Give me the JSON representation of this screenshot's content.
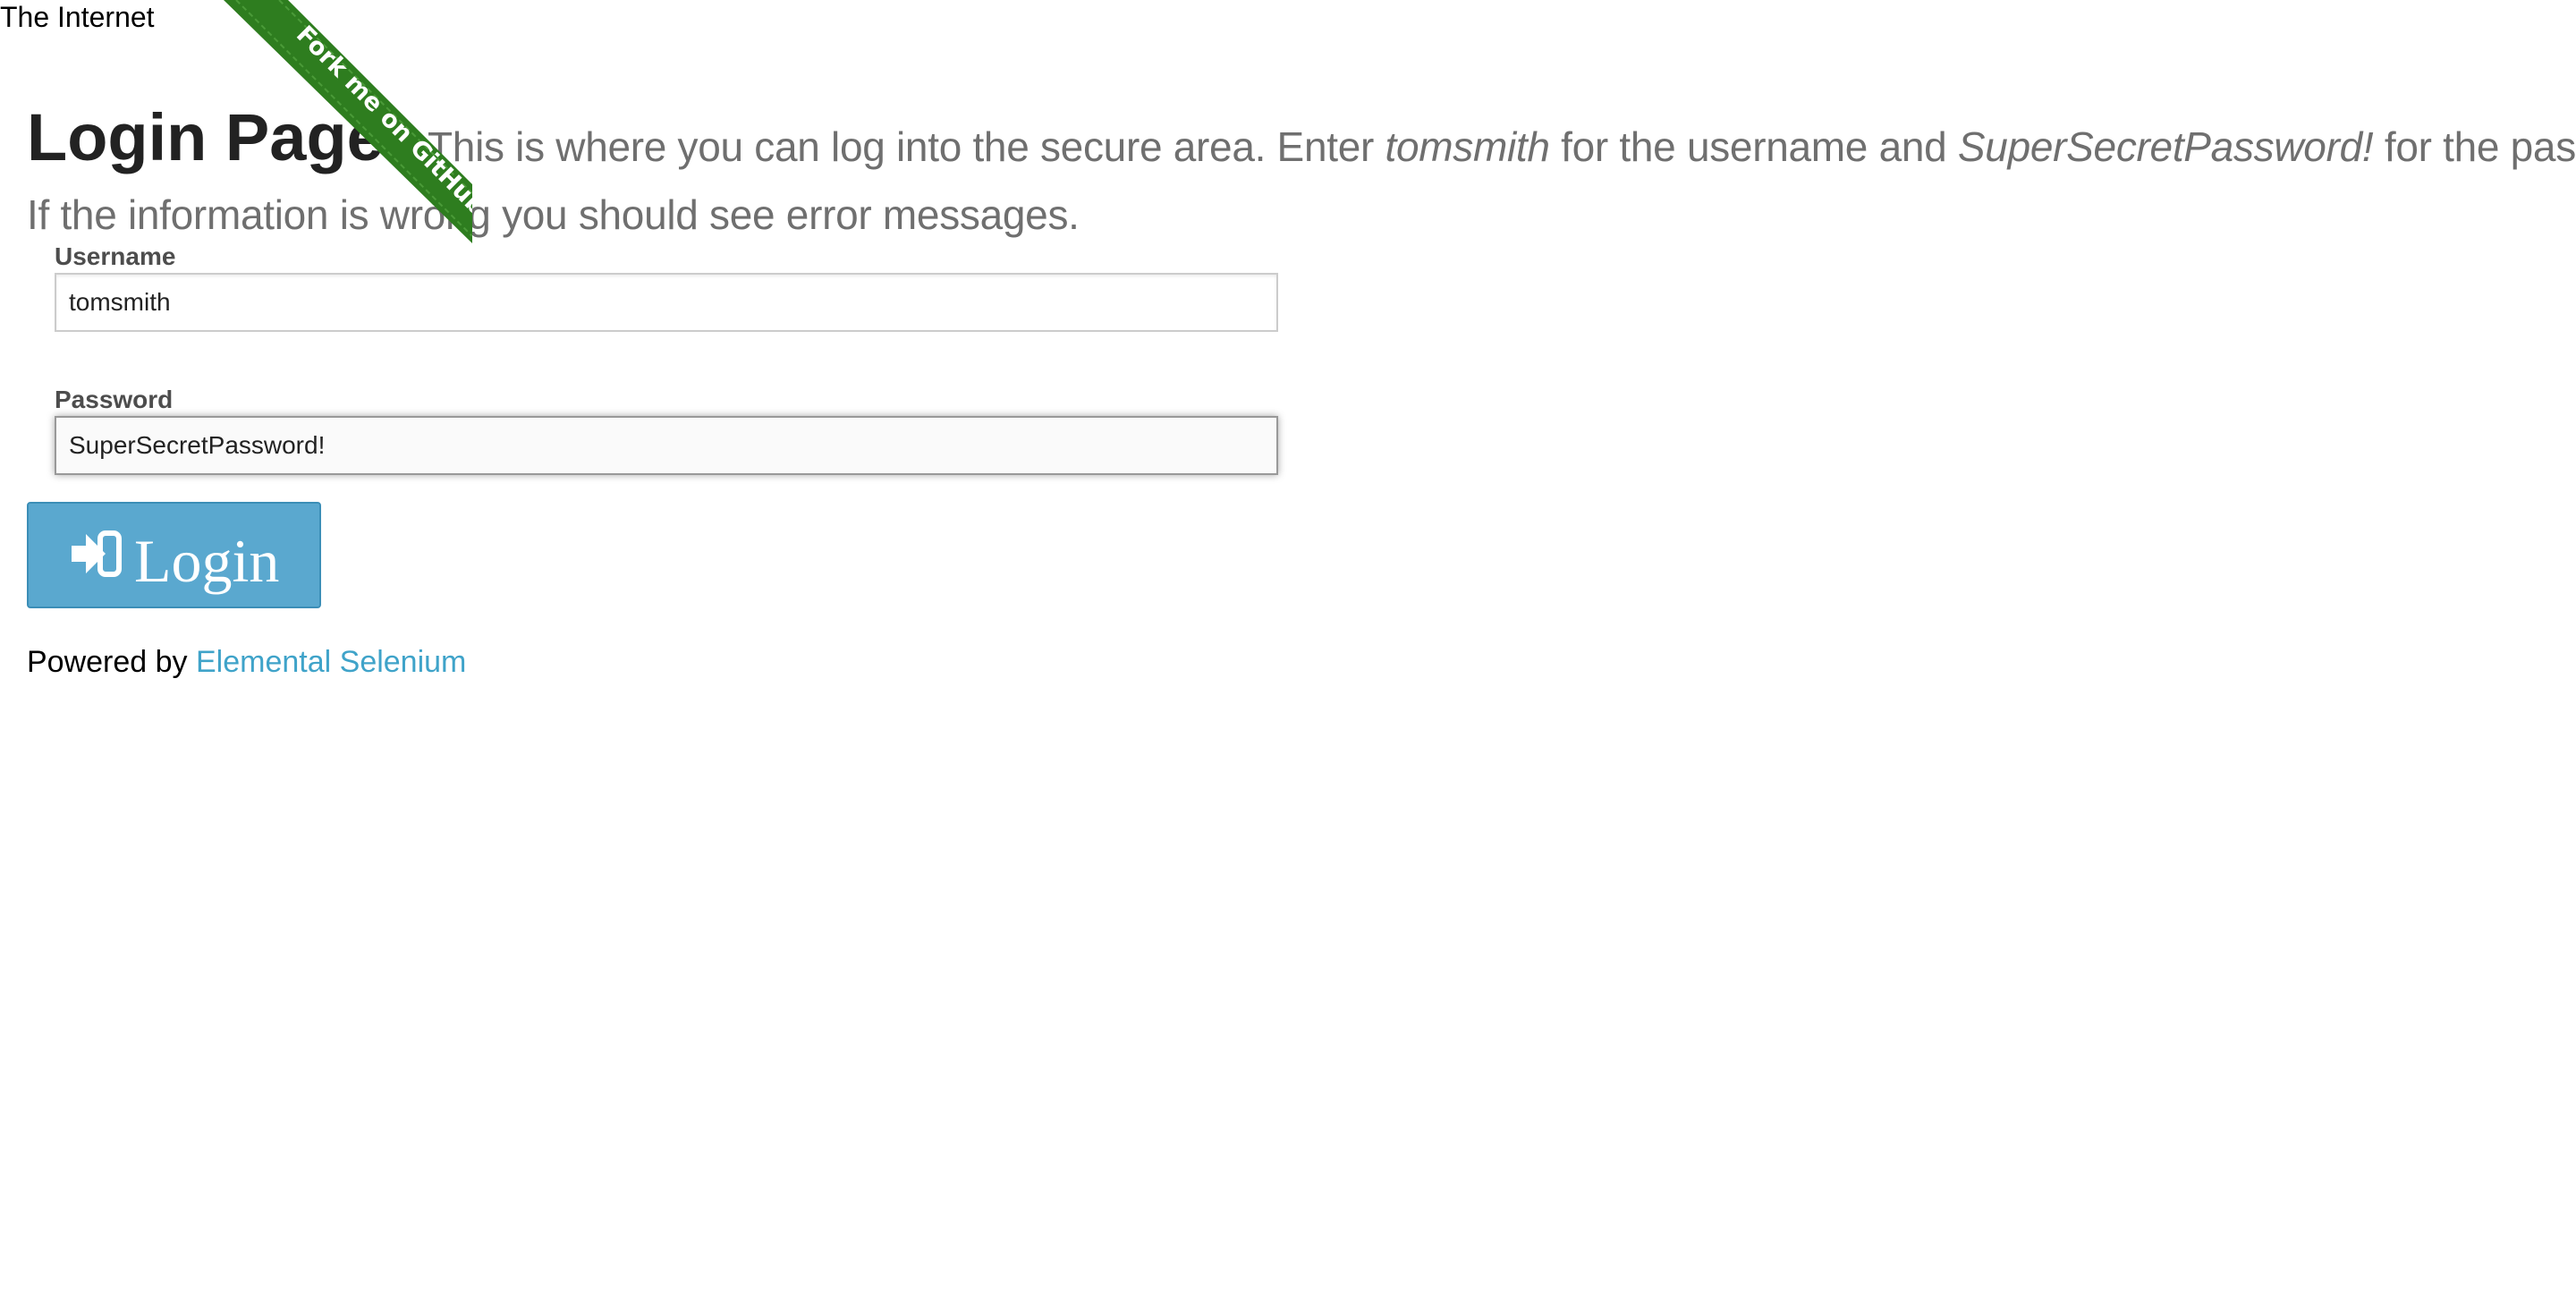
{
  "header": {
    "site_title": "The Internet"
  },
  "ribbon": {
    "label": "Fork me on GitHub",
    "color": "#2e7d1f"
  },
  "page": {
    "title": "Login Page",
    "subheader_part1": "This is where you can log into the secure area. Enter ",
    "subheader_username_hint": "tomsmith",
    "subheader_part2": " for the username and ",
    "subheader_password_hint": "SuperSecretPassword!",
    "subheader_part3": " for the password.",
    "subheader_line2": "If the information is wrong you should see error messages."
  },
  "form": {
    "username_label": "Username",
    "username_value": "tomsmith",
    "password_label": "Password",
    "password_value": "SuperSecretPassword!",
    "login_button_label": "Login",
    "login_button_icon": "sign-in-icon",
    "button_color": "#5aa8cf"
  },
  "footer": {
    "powered_by": "Powered by ",
    "link_text": "Elemental Selenium",
    "link_color": "#3fa3c9"
  }
}
